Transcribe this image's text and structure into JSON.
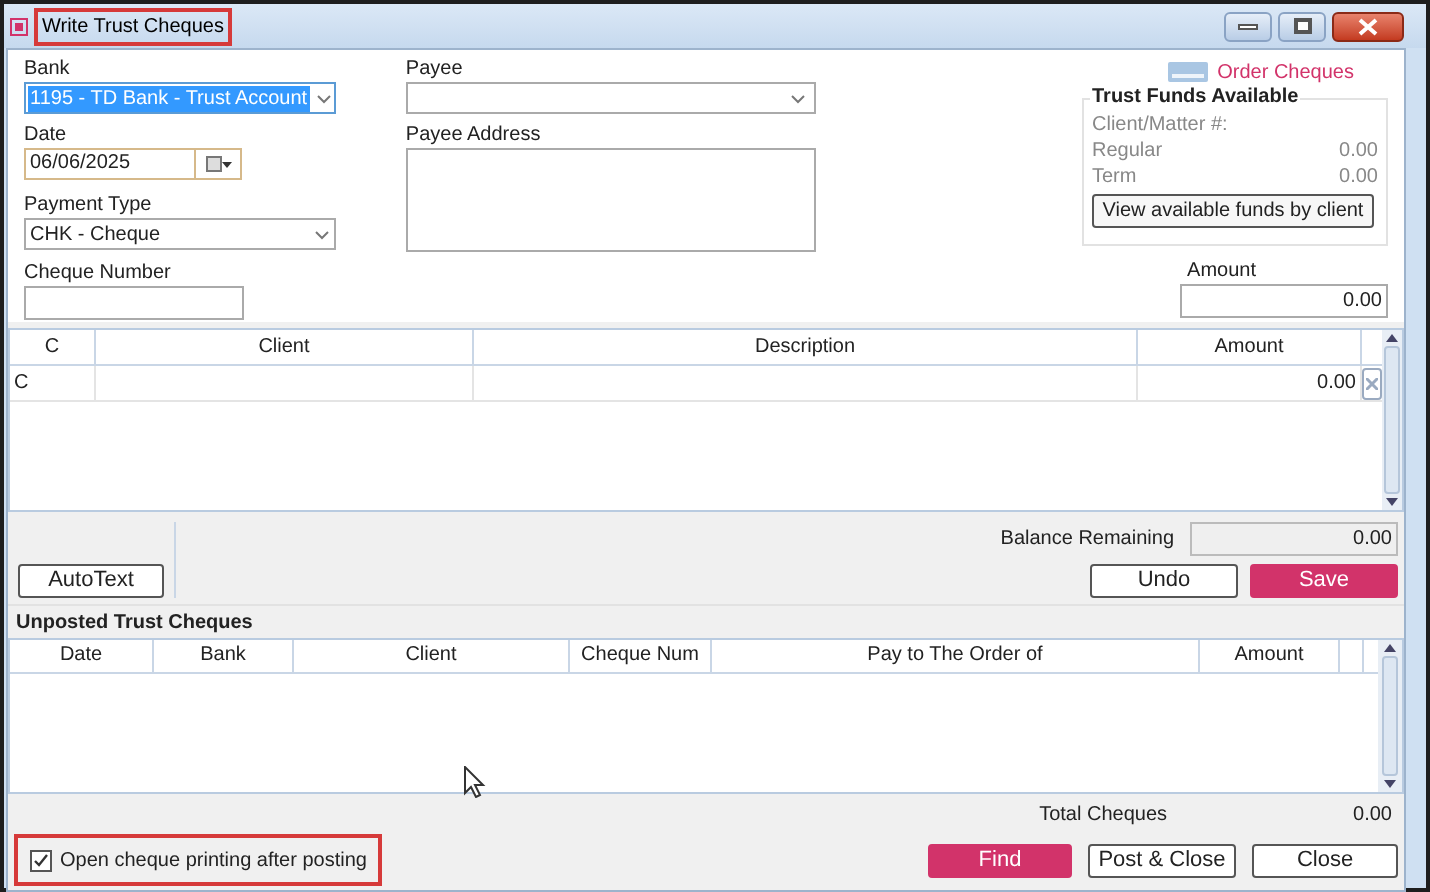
{
  "window": {
    "title": "Write Trust Cheques"
  },
  "form": {
    "bank": {
      "label": "Bank",
      "value": "1195 - TD Bank - Trust Account"
    },
    "date": {
      "label": "Date",
      "value": "06/06/2025"
    },
    "payment_type": {
      "label": "Payment Type",
      "value": "CHK - Cheque"
    },
    "cheque_number": {
      "label": "Cheque Number"
    },
    "payee": {
      "label": "Payee"
    },
    "payee_address": {
      "label": "Payee Address"
    },
    "order_cheques": "Order Cheques",
    "trust_funds": {
      "title": "Trust Funds Available",
      "client_matter_label": "Client/Matter #:",
      "rows": [
        {
          "label": "Regular",
          "value": "0.00"
        },
        {
          "label": "Term",
          "value": "0.00"
        }
      ],
      "button": "View available funds by client"
    },
    "amount": {
      "label": "Amount",
      "value": "0.00"
    }
  },
  "entry_grid": {
    "columns": [
      "C",
      "Client",
      "Description",
      "Amount"
    ],
    "rows": [
      {
        "c": "C",
        "amount": "0.00"
      }
    ]
  },
  "balance_remaining": {
    "label": "Balance Remaining",
    "value": "0.00"
  },
  "entry_buttons": [
    {
      "label": "AutoText",
      "kind": "default"
    },
    {
      "label": "Undo",
      "kind": "default"
    },
    {
      "label": "Save",
      "kind": "primary"
    }
  ],
  "unposted": {
    "title": "Unposted Trust Cheques",
    "columns": [
      "Date",
      "Bank",
      "Client",
      "Cheque Num",
      "Pay to The Order of",
      "Amount"
    ],
    "total": {
      "label": "Total Cheques",
      "value": "0.00"
    }
  },
  "open_printing": {
    "label": "Open cheque printing after posting",
    "checked": true
  },
  "footer_buttons": [
    {
      "label": "Find",
      "kind": "primary"
    },
    {
      "label": "Post & Close",
      "kind": "default"
    },
    {
      "label": "Close",
      "kind": "default"
    }
  ]
}
